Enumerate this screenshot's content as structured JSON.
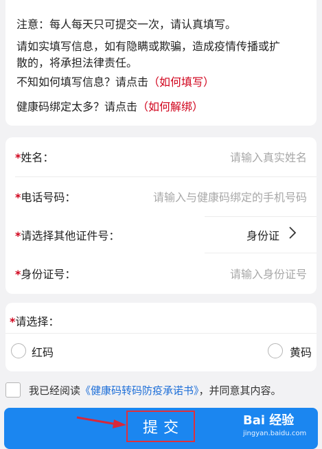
{
  "notice": {
    "line1": "注意：每人每天只可提交一次，请认真填写。",
    "line2a": "请如实填写信息，如有隐瞒或欺骗，造成疫情传播或扩",
    "line2b": "散的，将承担法律责任。",
    "line3_text": "不知如何填写信息？请点击",
    "line3_link": "（如何填写）",
    "line4_text": "健康码绑定太多？请点击",
    "line4_link": "（如何解绑）"
  },
  "form": {
    "name_label": "姓名：",
    "name_placeholder": "请输入真实姓名",
    "phone_label": "电话号码：",
    "phone_placeholder": "请输入与健康码绑定的手机号码",
    "id_type_label": "请选择其他证件号：",
    "id_type_value": "身份证",
    "id_number_label": "身份证号：",
    "id_number_placeholder": "请输入身份证号",
    "required_mark": "*"
  },
  "choice": {
    "label": "请选择：",
    "option_red": "红码",
    "option_yellow": "黄码"
  },
  "agreement": {
    "prefix": "我已经阅读",
    "link": "《健康码转码防疫承诺书》",
    "suffix": "，并同意其内容。"
  },
  "submit": {
    "label": "提交"
  },
  "watermark": {
    "brand": "Bai 经验",
    "url": "jingyan.baidu.com"
  },
  "colors": {
    "accent_red": "#d0021b",
    "primary_blue": "#1b86f0",
    "link_blue": "#1e6fd8"
  }
}
